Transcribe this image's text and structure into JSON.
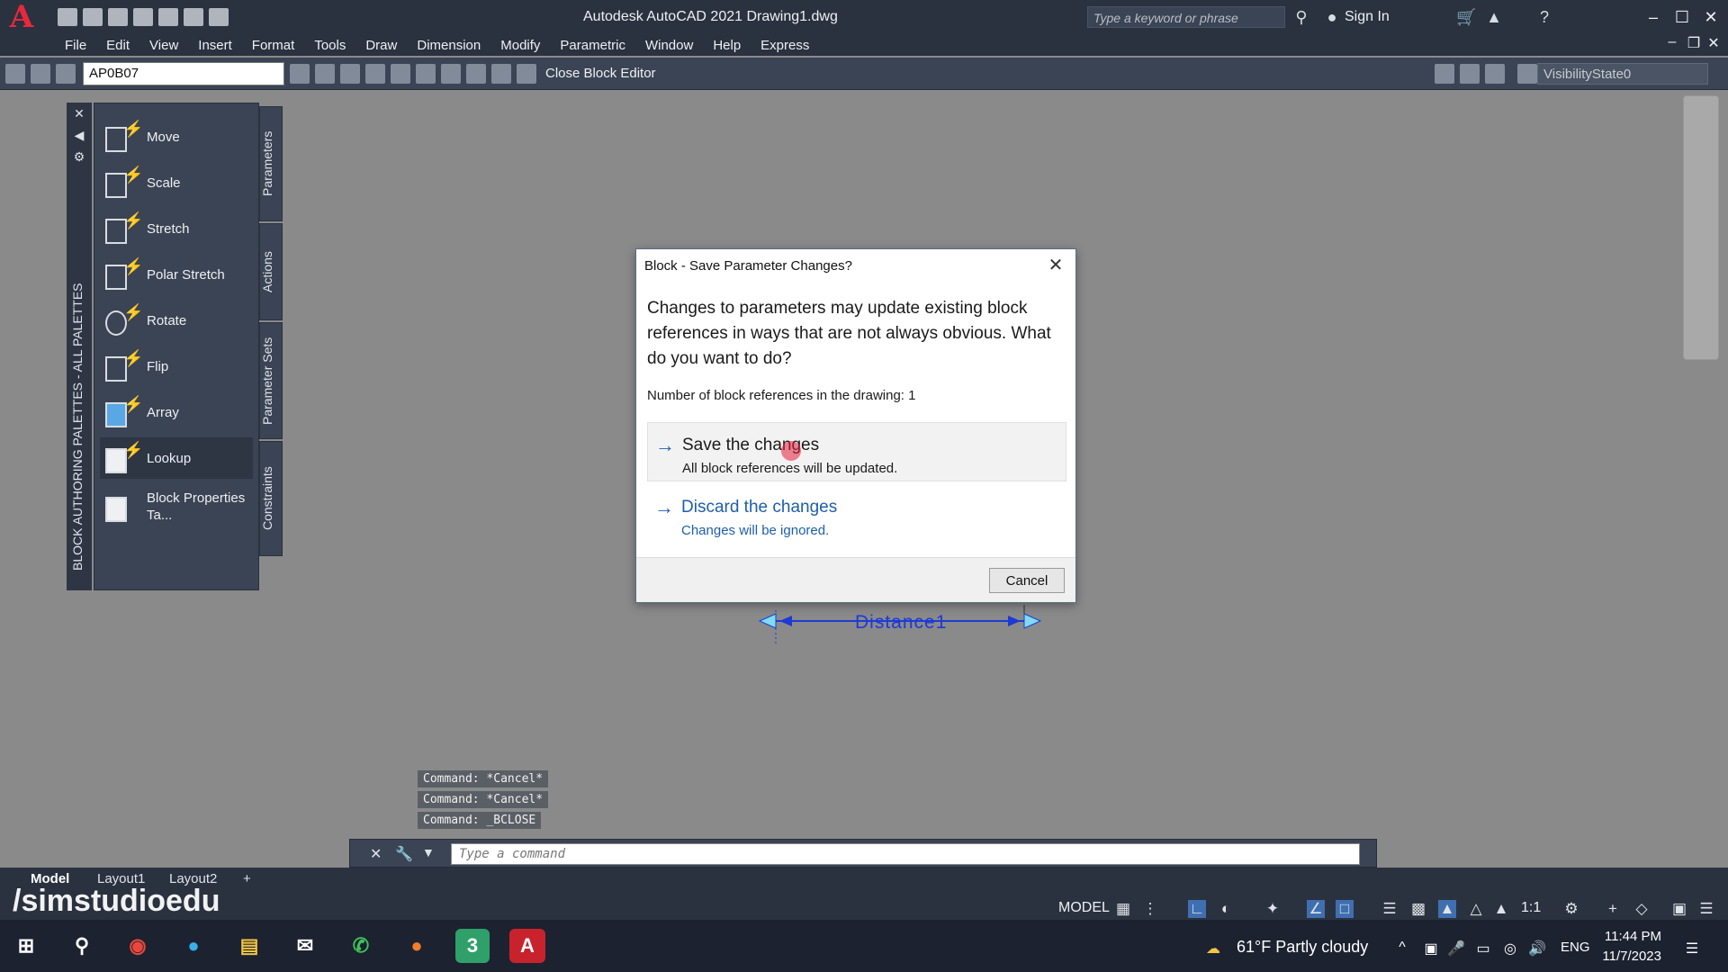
{
  "title_bar": {
    "window_title": "Autodesk AutoCAD 2021    Drawing1.dwg",
    "search_placeholder": "Type a keyword or phrase",
    "signin_label": "Sign In"
  },
  "menu": [
    "File",
    "Edit",
    "View",
    "Insert",
    "Format",
    "Tools",
    "Draw",
    "Dimension",
    "Modify",
    "Parametric",
    "Window",
    "Help",
    "Express"
  ],
  "block_toolbar": {
    "block_name_value": "AP0B07",
    "close_label": "Close Block Editor",
    "visibility_state": "VisibilityState0"
  },
  "palette": {
    "vertical_title": "BLOCK AUTHORING PALETTES - ALL PALETTES",
    "tools": [
      {
        "label": "Move"
      },
      {
        "label": "Scale"
      },
      {
        "label": "Stretch"
      },
      {
        "label": "Polar Stretch"
      },
      {
        "label": "Rotate"
      },
      {
        "label": "Flip"
      },
      {
        "label": "Array"
      },
      {
        "label": "Lookup"
      },
      {
        "label": "Block Properties Ta..."
      }
    ],
    "tabs": [
      "Parameters",
      "Actions",
      "Parameter Sets",
      "Constraints"
    ]
  },
  "dialog": {
    "title": "Block - Save Parameter Changes?",
    "main_text": "Changes to parameters may update existing block references in ways that are not always obvious. What do you want to do?",
    "count_text": "Number of block references in the drawing: 1",
    "save_title": "Save the changes",
    "save_desc": "All block references will be updated.",
    "discard_title": "Discard the changes",
    "discard_desc": "Changes will be ignored.",
    "cancel_label": "Cancel"
  },
  "drawing": {
    "distance_label": "Distance1"
  },
  "command": {
    "history": [
      "Command: *Cancel*",
      "Command: *Cancel*",
      "Command: _BCLOSE"
    ],
    "placeholder": "Type a command"
  },
  "layouts": {
    "tabs": [
      "Model",
      "Layout1",
      "Layout2"
    ],
    "add": "+"
  },
  "watermark": "/simstudioedu",
  "status": {
    "model": "MODEL",
    "scale": "1:1"
  },
  "taskbar": {
    "weather": "61°F  Partly cloudy",
    "language": "ENG",
    "time": "11:44 PM",
    "date": "11/7/2023"
  }
}
